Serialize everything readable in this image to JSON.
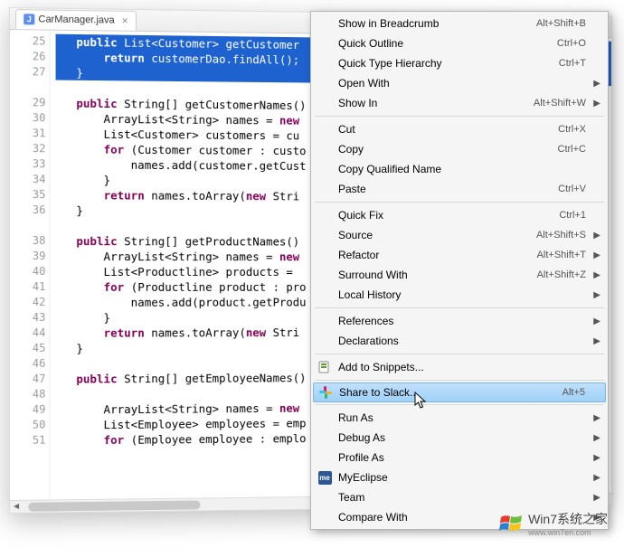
{
  "tab": {
    "filename": "CarManager.java"
  },
  "code": {
    "lines": [
      {
        "n": 25,
        "sel": true,
        "html": "   <span class='kw'>public</span> List&lt;Customer&gt; getCustomer"
      },
      {
        "n": 26,
        "sel": true,
        "html": "       <span class='kw'>return</span> customerDao.findAll();"
      },
      {
        "n": 27,
        "sel": true,
        "html": "   }"
      },
      {
        "n": "",
        "sel": false,
        "html": ""
      },
      {
        "n": 29,
        "sel": false,
        "html": "   <span class='kw'>public</span> String[] getCustomerNames()"
      },
      {
        "n": 30,
        "sel": false,
        "html": "       ArrayList&lt;String&gt; names = <span class='kw'>new</span>"
      },
      {
        "n": 31,
        "sel": false,
        "html": "       List&lt;Customer&gt; customers = cu"
      },
      {
        "n": 32,
        "sel": false,
        "html": "       <span class='kw'>for</span> (Customer customer : custo"
      },
      {
        "n": 33,
        "sel": false,
        "html": "           names.add(customer.getCust"
      },
      {
        "n": 34,
        "sel": false,
        "html": "       }"
      },
      {
        "n": 35,
        "sel": false,
        "html": "       <span class='kw'>return</span> names.toArray(<span class='kw'>new</span> Stri"
      },
      {
        "n": 36,
        "sel": false,
        "html": "   }"
      },
      {
        "n": "",
        "sel": false,
        "html": ""
      },
      {
        "n": 38,
        "sel": false,
        "html": "   <span class='kw'>public</span> String[] getProductNames()"
      },
      {
        "n": 39,
        "sel": false,
        "html": "       ArrayList&lt;String&gt; names = <span class='kw'>new</span>"
      },
      {
        "n": 40,
        "sel": false,
        "html": "       List&lt;Productline&gt; products = "
      },
      {
        "n": 41,
        "sel": false,
        "html": "       <span class='kw'>for</span> (Productline product : pro"
      },
      {
        "n": 42,
        "sel": false,
        "html": "           names.add(product.getProdu"
      },
      {
        "n": 43,
        "sel": false,
        "html": "       }"
      },
      {
        "n": 44,
        "sel": false,
        "html": "       <span class='kw'>return</span> names.toArray(<span class='kw'>new</span> Stri"
      },
      {
        "n": 45,
        "sel": false,
        "html": "   }"
      },
      {
        "n": 46,
        "sel": false,
        "html": ""
      },
      {
        "n": 47,
        "sel": false,
        "html": "   <span class='kw'>public</span> String[] getEmployeeNames()"
      },
      {
        "n": 48,
        "sel": false,
        "html": ""
      },
      {
        "n": 49,
        "sel": false,
        "html": "       ArrayList&lt;String&gt; names = <span class='kw'>new</span>"
      },
      {
        "n": 50,
        "sel": false,
        "html": "       List&lt;Employee&gt; employees = emp"
      },
      {
        "n": 51,
        "sel": false,
        "html": "       <span class='kw'>for</span> (Employee employee : emplo"
      }
    ],
    "fold_rows": [
      0,
      4,
      13,
      22
    ]
  },
  "menu": {
    "groups": [
      [
        {
          "label": "Show in Breadcrumb",
          "accel": "Alt+Shift+B"
        },
        {
          "label": "Quick Outline",
          "accel": "Ctrl+O"
        },
        {
          "label": "Quick Type Hierarchy",
          "accel": "Ctrl+T"
        },
        {
          "label": "Open With",
          "submenu": true
        },
        {
          "label": "Show In",
          "accel": "Alt+Shift+W",
          "submenu": true
        }
      ],
      [
        {
          "label": "Cut",
          "accel": "Ctrl+X"
        },
        {
          "label": "Copy",
          "accel": "Ctrl+C"
        },
        {
          "label": "Copy Qualified Name"
        },
        {
          "label": "Paste",
          "accel": "Ctrl+V"
        }
      ],
      [
        {
          "label": "Quick Fix",
          "accel": "Ctrl+1"
        },
        {
          "label": "Source",
          "accel": "Alt+Shift+S",
          "submenu": true
        },
        {
          "label": "Refactor",
          "accel": "Alt+Shift+T",
          "submenu": true
        },
        {
          "label": "Surround With",
          "accel": "Alt+Shift+Z",
          "submenu": true
        },
        {
          "label": "Local History",
          "submenu": true
        }
      ],
      [
        {
          "label": "References",
          "submenu": true
        },
        {
          "label": "Declarations",
          "submenu": true
        }
      ],
      [
        {
          "label": "Add to Snippets...",
          "icon": "snippet"
        }
      ],
      [
        {
          "label": "Share to Slack...",
          "accel": "Alt+5",
          "icon": "slack",
          "highlight": true
        }
      ],
      [
        {
          "label": "Run As",
          "submenu": true
        },
        {
          "label": "Debug As",
          "submenu": true
        },
        {
          "label": "Profile As",
          "submenu": true
        },
        {
          "label": "MyEclipse",
          "submenu": true,
          "icon": "me"
        },
        {
          "label": "Team",
          "submenu": true
        },
        {
          "label": "Compare With",
          "submenu": true
        }
      ]
    ]
  },
  "watermark": {
    "text_cn": "系统之家",
    "text_prefix": "Win7",
    "sub": "www.win7en.com"
  }
}
